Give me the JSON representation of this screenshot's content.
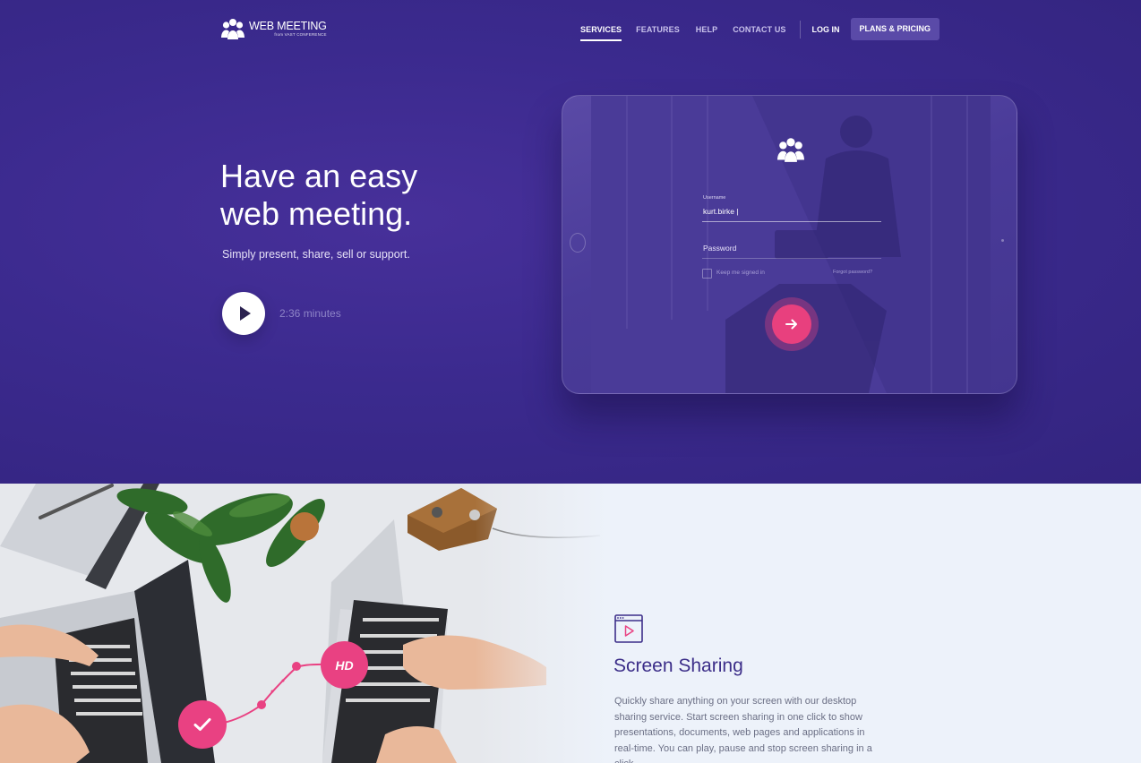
{
  "brand": {
    "name": "WEB MEETING",
    "tagline": "from VAST CONFERENCE"
  },
  "nav": {
    "items": [
      "SERVICES",
      "FEATURES",
      "HELP",
      "CONTACT US"
    ],
    "active": "SERVICES",
    "login": "LOG IN",
    "pricing": "PLANS & PRICING"
  },
  "hero": {
    "headline_line1": "Have an easy",
    "headline_line2": "web meeting.",
    "subheading": "Simply present, share, sell or support.",
    "video_duration": "2:36 minutes"
  },
  "login_form": {
    "username_label": "Username",
    "username_value": "kurt.birke |",
    "password_placeholder": "Password",
    "keep_signed_in": "Keep me signed in",
    "forgot_password": "Forgot password?",
    "submit_icon": "arrow-right-icon"
  },
  "feature": {
    "icon": "screen-play-icon",
    "title": "Screen Sharing",
    "description": "Quickly share anything on your screen with our desktop sharing service. Start screen sharing in one click to show presentations, documents, web pages and applications in real-time. You can play, pause and stop screen sharing in a click."
  },
  "badges": {
    "hd": "HD",
    "check_icon": "check-icon"
  },
  "colors": {
    "hero_bg": "#3b2a8e",
    "accent_pink": "#e8407e",
    "pricing_btn": "#5a4aa8",
    "feature_title": "#3c2e89",
    "section_bg": "#edf2fa"
  }
}
